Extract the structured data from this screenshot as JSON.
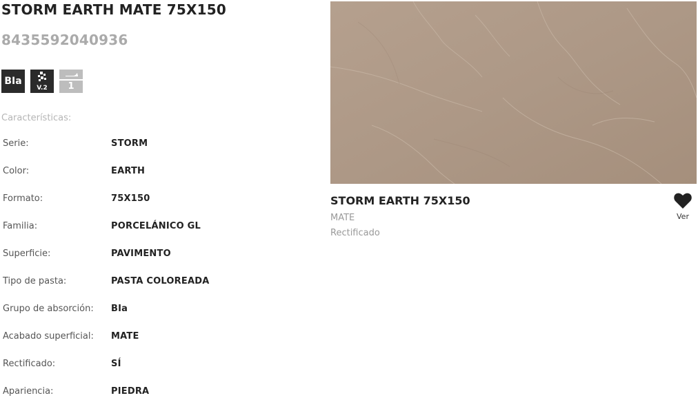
{
  "product": {
    "title": "STORM EARTH MATE 75X150",
    "code": "8435592040936"
  },
  "badges": {
    "absorption": "BIa",
    "variation": "V.2",
    "use_level": "1"
  },
  "specs": {
    "heading": "Características:",
    "rows": [
      {
        "label": "Serie:",
        "value": "STORM"
      },
      {
        "label": "Color:",
        "value": "EARTH"
      },
      {
        "label": "Formato:",
        "value": "75X150"
      },
      {
        "label": "Familia:",
        "value": "PORCELÁNICO GL"
      },
      {
        "label": "Superficie:",
        "value": "PAVIMENTO"
      },
      {
        "label": "Tipo de pasta:",
        "value": "PASTA COLOREADA"
      },
      {
        "label": "Grupo de absorción:",
        "value": "BIa"
      },
      {
        "label": "Acabado superficial:",
        "value": "MATE"
      },
      {
        "label": "Rectificado:",
        "value": "SÍ"
      },
      {
        "label": "Apariencia:",
        "value": "PIEDRA"
      }
    ]
  },
  "card": {
    "name": "STORM EARTH 75X150",
    "finish": "MATE",
    "edge": "Rectificado",
    "favorite_label": "Ver",
    "favorite_icon": "heart-icon",
    "tile_color": "#ad9886"
  },
  "colors": {
    "text_dark": "#222222",
    "text_muted": "#aaaaaa",
    "badge_dark": "#2b2b2b",
    "badge_light": "#bdbdbd"
  }
}
